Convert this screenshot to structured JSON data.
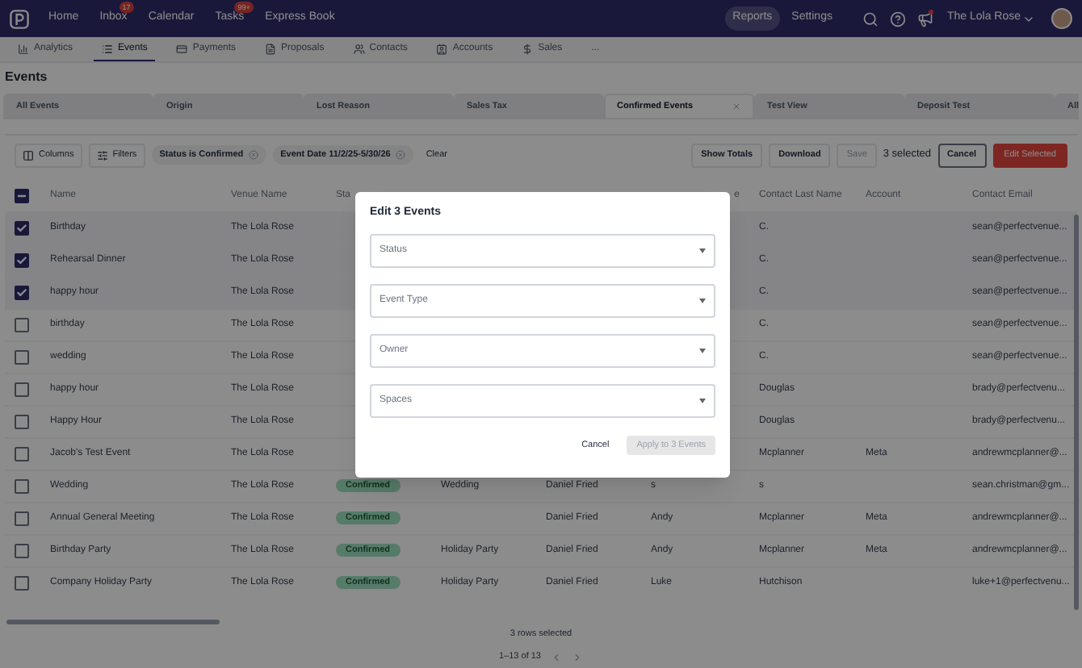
{
  "nav": {
    "items": [
      {
        "label": "Home"
      },
      {
        "label": "Inbox",
        "badge": "17"
      },
      {
        "label": "Calendar"
      },
      {
        "label": "Tasks",
        "badge": "99+"
      },
      {
        "label": "Express Book"
      }
    ],
    "right_items": [
      {
        "label": "Reports",
        "selected": true
      },
      {
        "label": "Settings",
        "selected": false
      }
    ],
    "venue": "The Lola Rose"
  },
  "subnav": [
    {
      "label": "Analytics",
      "kind": "analytics",
      "selected": false
    },
    {
      "label": "Events",
      "kind": "events",
      "selected": true
    },
    {
      "label": "Payments",
      "kind": "payments",
      "selected": false
    },
    {
      "label": "Proposals",
      "kind": "proposals",
      "selected": false
    },
    {
      "label": "Contacts",
      "kind": "contacts",
      "selected": false
    },
    {
      "label": "Accounts",
      "kind": "accounts",
      "selected": false
    },
    {
      "label": "Sales",
      "kind": "sales",
      "selected": false
    },
    {
      "label": "...",
      "kind": "more",
      "selected": false
    }
  ],
  "page_title": "Events",
  "views": [
    {
      "label": "All Events",
      "selected": false
    },
    {
      "label": "Origin",
      "selected": false
    },
    {
      "label": "Lost Reason",
      "selected": false
    },
    {
      "label": "Sales Tax",
      "selected": false
    },
    {
      "label": "Confirmed Events",
      "selected": true
    },
    {
      "label": "Test View",
      "selected": false
    },
    {
      "label": "Deposit Test",
      "selected": false
    },
    {
      "label": "All",
      "selected": false
    }
  ],
  "toolbar": {
    "columns": "Columns",
    "filters": "Filters",
    "chips": [
      "Status is Confirmed",
      "Event Date 11/2/25-5/30/26"
    ],
    "clear": "Clear",
    "show_totals": "Show Totals",
    "download": "Download",
    "save": {
      "label": "Save",
      "disabled": true
    },
    "selected_count": "3 selected",
    "cancel": "Cancel",
    "edit_selected": "Edit Selected"
  },
  "table": {
    "header_checkbox": {
      "indeterminate": true
    },
    "columns": [
      {
        "label": "Name"
      },
      {
        "label": "Venue Name"
      },
      {
        "label": "Sta",
        "kind": "badge"
      },
      {},
      {},
      {
        "label": "e"
      },
      {
        "label": "Contact Last Name"
      },
      {
        "label": "Account"
      },
      {
        "label": "Contact Email"
      }
    ],
    "rows": [
      {
        "selected": true,
        "cells": {
          "name": "Birthday",
          "venue": "The Lola Rose",
          "last": "C.",
          "email": "sean@perfectvenue..."
        }
      },
      {
        "selected": true,
        "cells": {
          "name": "Rehearsal Dinner",
          "venue": "The Lola Rose",
          "last": "C.",
          "email": "sean@perfectvenue..."
        }
      },
      {
        "selected": true,
        "cells": {
          "name": "happy hour",
          "venue": "The Lola Rose",
          "last": "C.",
          "email": "sean@perfectvenue..."
        }
      },
      {
        "selected": false,
        "cells": {
          "name": "birthday",
          "venue": "The Lola Rose",
          "last": "C.",
          "email": "sean@perfectvenue..."
        }
      },
      {
        "selected": false,
        "cells": {
          "name": "wedding",
          "venue": "The Lola Rose",
          "last": "C.",
          "email": "sean@perfectvenue..."
        }
      },
      {
        "selected": false,
        "cells": {
          "name": "happy hour",
          "venue": "The Lola Rose",
          "last": "Douglas",
          "email": "brady@perfectvenu..."
        }
      },
      {
        "selected": false,
        "cells": {
          "name": "Happy Hour",
          "venue": "The Lola Rose",
          "last": "Douglas",
          "email": "brady@perfectvenu..."
        }
      },
      {
        "selected": false,
        "cells": {
          "name": "Jacob's Test Event",
          "venue": "The Lola Rose",
          "last": "Mcplanner",
          "account": "Meta",
          "email": "andrewmcplanner@..."
        }
      },
      {
        "selected": false,
        "cells": {
          "name": "Wedding",
          "venue": "The Lola Rose",
          "status": "Confirmed",
          "type": "Wedding",
          "owner": "Daniel Fried",
          "first": "s",
          "last": "s",
          "email": "sean.christman@gm..."
        }
      },
      {
        "selected": false,
        "cells": {
          "name": "Annual General Meeting",
          "venue": "The Lola Rose",
          "status": "Confirmed",
          "owner": "Daniel Fried",
          "first": "Andy",
          "last": "Mcplanner",
          "account": "Meta",
          "email": "andrewmcplanner@..."
        }
      },
      {
        "selected": false,
        "cells": {
          "name": "Birthday Party",
          "venue": "The Lola Rose",
          "status": "Confirmed",
          "type": "Holiday Party",
          "owner": "Daniel Fried",
          "first": "Andy",
          "last": "Mcplanner",
          "account": "Meta",
          "email": "andrewmcplanner@..."
        }
      },
      {
        "selected": false,
        "cells": {
          "name": "Company Holiday Party",
          "venue": "The Lola Rose",
          "status": "Confirmed",
          "type": "Holiday Party",
          "owner": "Daniel Fried",
          "first": "Luke",
          "last": "Hutchison",
          "email": "luke+1@perfectvenu..."
        }
      }
    ],
    "rows_selected": "3 rows selected",
    "pagination": "1–13 of 13"
  },
  "modal": {
    "title": "Edit 3 Events",
    "fields": [
      {
        "placeholder": "Status"
      },
      {
        "placeholder": "Event Type"
      },
      {
        "placeholder": "Owner"
      },
      {
        "placeholder": "Spaces"
      }
    ],
    "cancel": "Cancel",
    "apply": {
      "label": "Apply to 3 Events",
      "disabled": true
    }
  }
}
